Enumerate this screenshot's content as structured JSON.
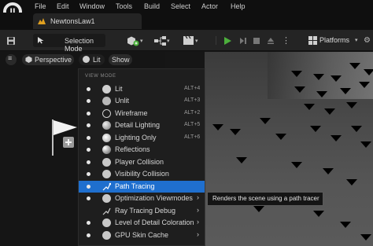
{
  "menu": {
    "items": [
      "File",
      "Edit",
      "Window",
      "Tools",
      "Build",
      "Select",
      "Actor",
      "Help"
    ]
  },
  "document_tab": {
    "name": "NewtonsLaw1"
  },
  "toolbar": {
    "mode_label": "Selection Mode",
    "platforms_label": "Platforms"
  },
  "viewport_toolbar": {
    "perspective_label": "Perspective",
    "view_mode_label": "Lit",
    "show_label": "Show"
  },
  "view_mode_menu": {
    "header": "VIEW MODE",
    "items": [
      {
        "label": "Lit",
        "shortcut": "ALT+4",
        "icon": "lit-sphere-icon"
      },
      {
        "label": "Unlit",
        "shortcut": "ALT+3",
        "icon": "unlit-sphere-icon"
      },
      {
        "label": "Wireframe",
        "shortcut": "ALT+2",
        "icon": "wireframe-icon"
      },
      {
        "label": "Detail Lighting",
        "shortcut": "ALT+5",
        "icon": "detail-lighting-icon"
      },
      {
        "label": "Lighting Only",
        "shortcut": "ALT+6",
        "icon": "lighting-only-icon"
      },
      {
        "label": "Reflections",
        "shortcut": "",
        "icon": "reflections-icon"
      },
      {
        "label": "Player Collision",
        "shortcut": "",
        "icon": "player-collision-icon"
      },
      {
        "label": "Visibility Collision",
        "shortcut": "",
        "icon": "visibility-collision-icon"
      },
      {
        "label": "Path Tracing",
        "shortcut": "",
        "icon": "path-tracing-icon"
      },
      {
        "label": "Optimization Viewmodes",
        "shortcut": "",
        "icon": "optimization-icon"
      },
      {
        "label": "Ray Tracing Debug",
        "shortcut": "",
        "icon": "ray-tracing-debug-icon"
      },
      {
        "label": "Level of Detail Coloration",
        "shortcut": "",
        "icon": "lod-coloration-icon"
      },
      {
        "label": "GPU Skin Cache",
        "shortcut": "",
        "icon": "gpu-skin-cache-icon"
      }
    ]
  },
  "tooltip": {
    "text": "Renders the scene using a path tracer"
  },
  "colors": {
    "accent": "#1f6fce",
    "play_green": "#4caf3c",
    "background": "#151515"
  }
}
